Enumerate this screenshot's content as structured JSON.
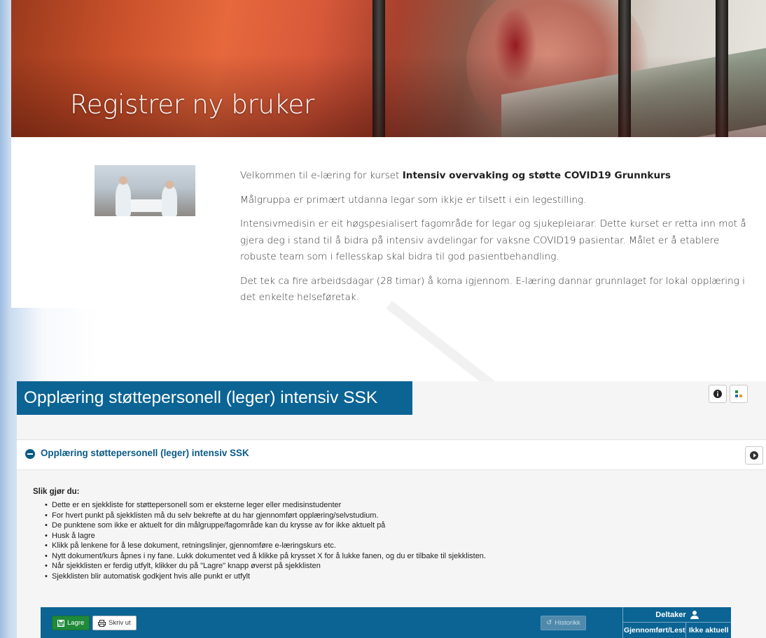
{
  "hero": {
    "title": "Registrer ny bruker"
  },
  "intro": {
    "welcome_prefix": "Velkommen til e-læring for kurset ",
    "course_name": "Intensiv overvaking og støtte COVID19 Grunnkurs",
    "paragraphs": [
      "Målgruppa er primært utdanna legar som ikkje er tilsett i ein legestilling.",
      "Intensivmedisin er eit høgspesialisert fagområde for legar og sjukepleiarar. Dette kurset er retta inn mot å gjera deg i stand til å bidra på intensiv avdelingar for vaksne COVID19 pasientar.  Målet er å etablere robuste team som i fellesskap skal bidra til god pasientbehandling.",
      "Det tek ca fire arbeidsdagar (28 timar) å koma igjennom. E-læring dannar grunnlaget for lokal opplæring i det enkelte helseføretak."
    ]
  },
  "checklist": {
    "header_title": "Opplæring støttepersonell (leger) intensiv SSK",
    "accordion_title": "Opplæring støttepersonell (leger) intensiv SSK",
    "instructions_title": "Slik gjør du:",
    "instructions": [
      "Dette er en sjekkliste for støttepersonell som er eksterne leger eller medisinstudenter",
      "For hvert punkt på sjekklisten må du selv bekrefte at du har gjennomført opplæring/selvstudium.",
      "De punktene som ikke er aktuelt for din målgruppe/fagområde kan du krysse av for ikke aktuelt på",
      "Husk å lagre",
      "Klikk på lenkene for å lese dokument, retningslinjer, gjennomføre e-læringskurs etc.",
      "Nytt dokument/kurs åpnes i ny fane. Lukk dokumentet ved å klikke på krysset X for å lukke fanen, og du er tilbake til sjekklisten.",
      "Når sjekklisten er ferdig utfylt, klikker du på \"Lagre\" knapp øverst på sjekklisten",
      "Sjekklisten blir automatisk godkjent hvis alle punkt er utfylt"
    ],
    "toolbar": {
      "save_label": "Lagre",
      "print_label": "Skriv ut",
      "history_label": "Historikk"
    },
    "participant": {
      "title": "Deltaker",
      "col_completed": "Gjennomført/Lest",
      "col_not_relevant": "Ikke aktuell"
    }
  },
  "icons": {
    "info": "info-icon",
    "help": "help-icon",
    "collapse": "minus-circle-icon",
    "play": "play-circle-icon",
    "save": "floppy-disk-icon",
    "print": "printer-icon",
    "history": "history-icon",
    "user": "user-icon"
  },
  "colors": {
    "primary_blue": "#0b6494",
    "save_green": "#1f8a3a"
  }
}
